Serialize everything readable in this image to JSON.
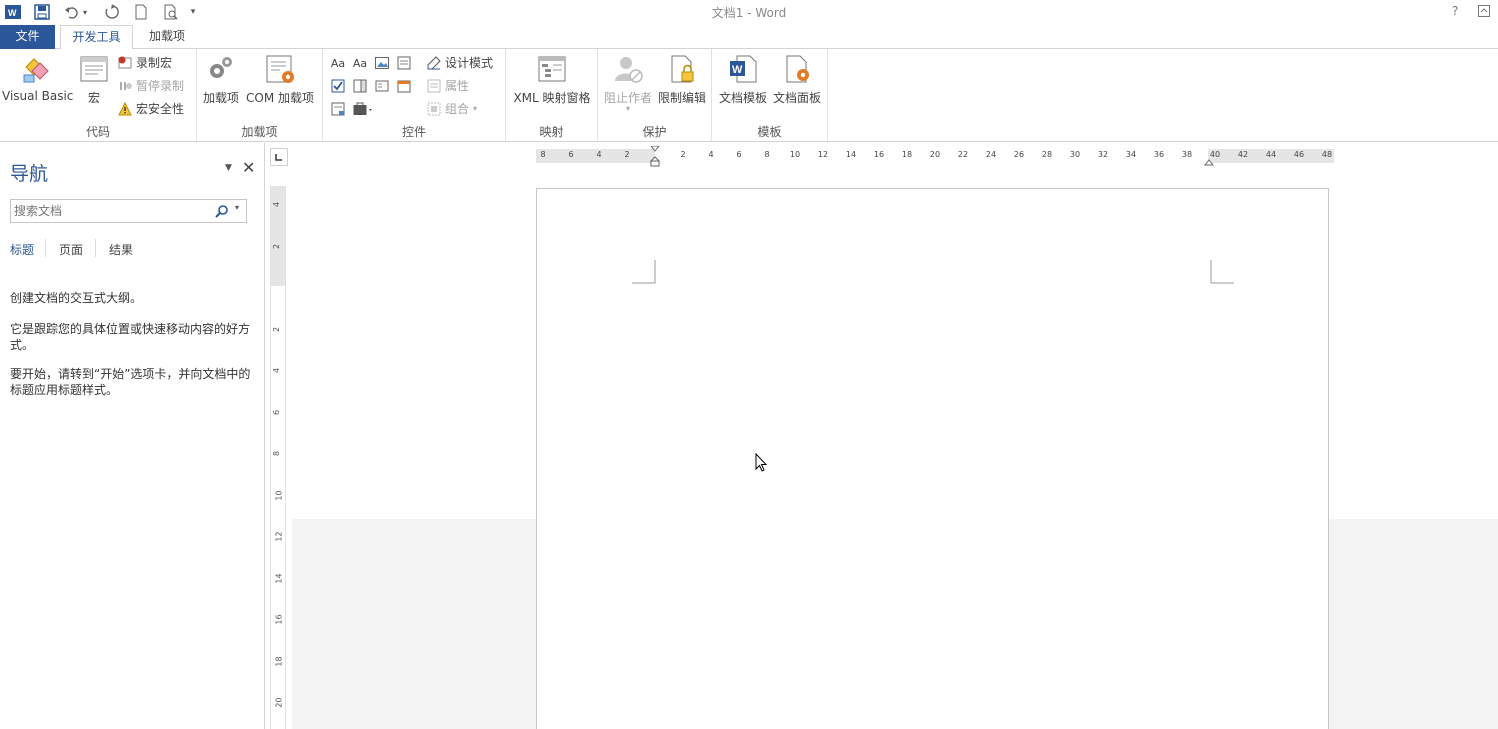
{
  "titlebar": {
    "title": "文档1 - Word",
    "help": "?",
    "icons": [
      "word-app-icon",
      "save-icon",
      "undo-icon",
      "redo-icon",
      "new-doc-icon",
      "print-preview-icon",
      "customize-qat-icon"
    ]
  },
  "tabs": {
    "file": "文件",
    "developer": "开发工具",
    "addins": "加载项"
  },
  "ribbon": {
    "code": {
      "label": "代码",
      "visual_basic": "Visual Basic",
      "macros": "宏",
      "record_macro": "录制宏",
      "pause_recording": "暂停录制",
      "macro_security": "宏安全性"
    },
    "addins": {
      "label": "加载项",
      "addins": "加载项",
      "com_addins": "COM 加载项"
    },
    "controls": {
      "label": "控件",
      "design_mode": "设计模式",
      "properties": "属性",
      "group": "组合"
    },
    "mapping": {
      "label": "映射",
      "xml_pane": "XML 映射窗格"
    },
    "protect": {
      "label": "保护",
      "block_authors": "阻止作者",
      "restrict_editing": "限制编辑"
    },
    "templates": {
      "label": "模板",
      "document_template": "文档模板",
      "document_panel": "文档面板"
    }
  },
  "nav": {
    "title": "导航",
    "search_placeholder": "搜索文档",
    "tabs": [
      "标题",
      "页面",
      "结果"
    ],
    "p1": "创建文档的交互式大纲。",
    "p2": "它是跟踪您的具体位置或快速移动内容的好方式。",
    "p3": "要开始，请转到“开始”选项卡，并向文档中的标题应用标题样式。"
  },
  "hruler": {
    "ticks": [
      "8",
      "6",
      "4",
      "2",
      "",
      "2",
      "4",
      "6",
      "8",
      "10",
      "12",
      "14",
      "16",
      "18",
      "20",
      "22",
      "24",
      "26",
      "28",
      "30",
      "32",
      "34",
      "36",
      "38",
      "40",
      "42",
      "44",
      "46",
      "48"
    ]
  },
  "vruler": {
    "ticks": [
      "4",
      "2",
      "",
      "2",
      "4",
      "6",
      "8",
      "10",
      "12",
      "14",
      "16",
      "18",
      "20"
    ]
  },
  "colors": {
    "accent": "#2b579a",
    "macro_red": "#c0392b",
    "addin_orange": "#e07b27"
  }
}
